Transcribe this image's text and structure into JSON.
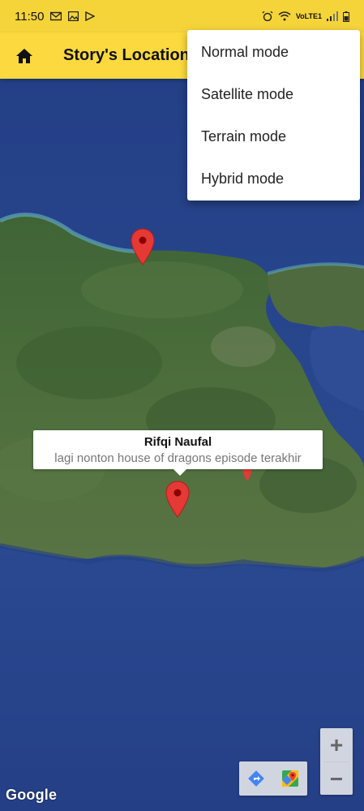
{
  "status_bar": {
    "time": "11:50",
    "network": "VoLTE1"
  },
  "app_bar": {
    "title": "Story's Location"
  },
  "menu": {
    "items": [
      "Normal mode",
      "Satellite mode",
      "Terrain mode",
      "Hybrid mode"
    ]
  },
  "map": {
    "info_window": {
      "title": "Rifqi Naufal",
      "snippet": "lagi nonton house of dragons episode terakhir"
    },
    "zoom_in_label": "+",
    "zoom_out_label": "−",
    "attribution": "Google",
    "marker_color": "#e53935"
  },
  "colors": {
    "app_bar": "#fbd93f",
    "status_bar": "#f5d43a",
    "ocean": "#2a4a91",
    "land": "#4e6b3a"
  }
}
